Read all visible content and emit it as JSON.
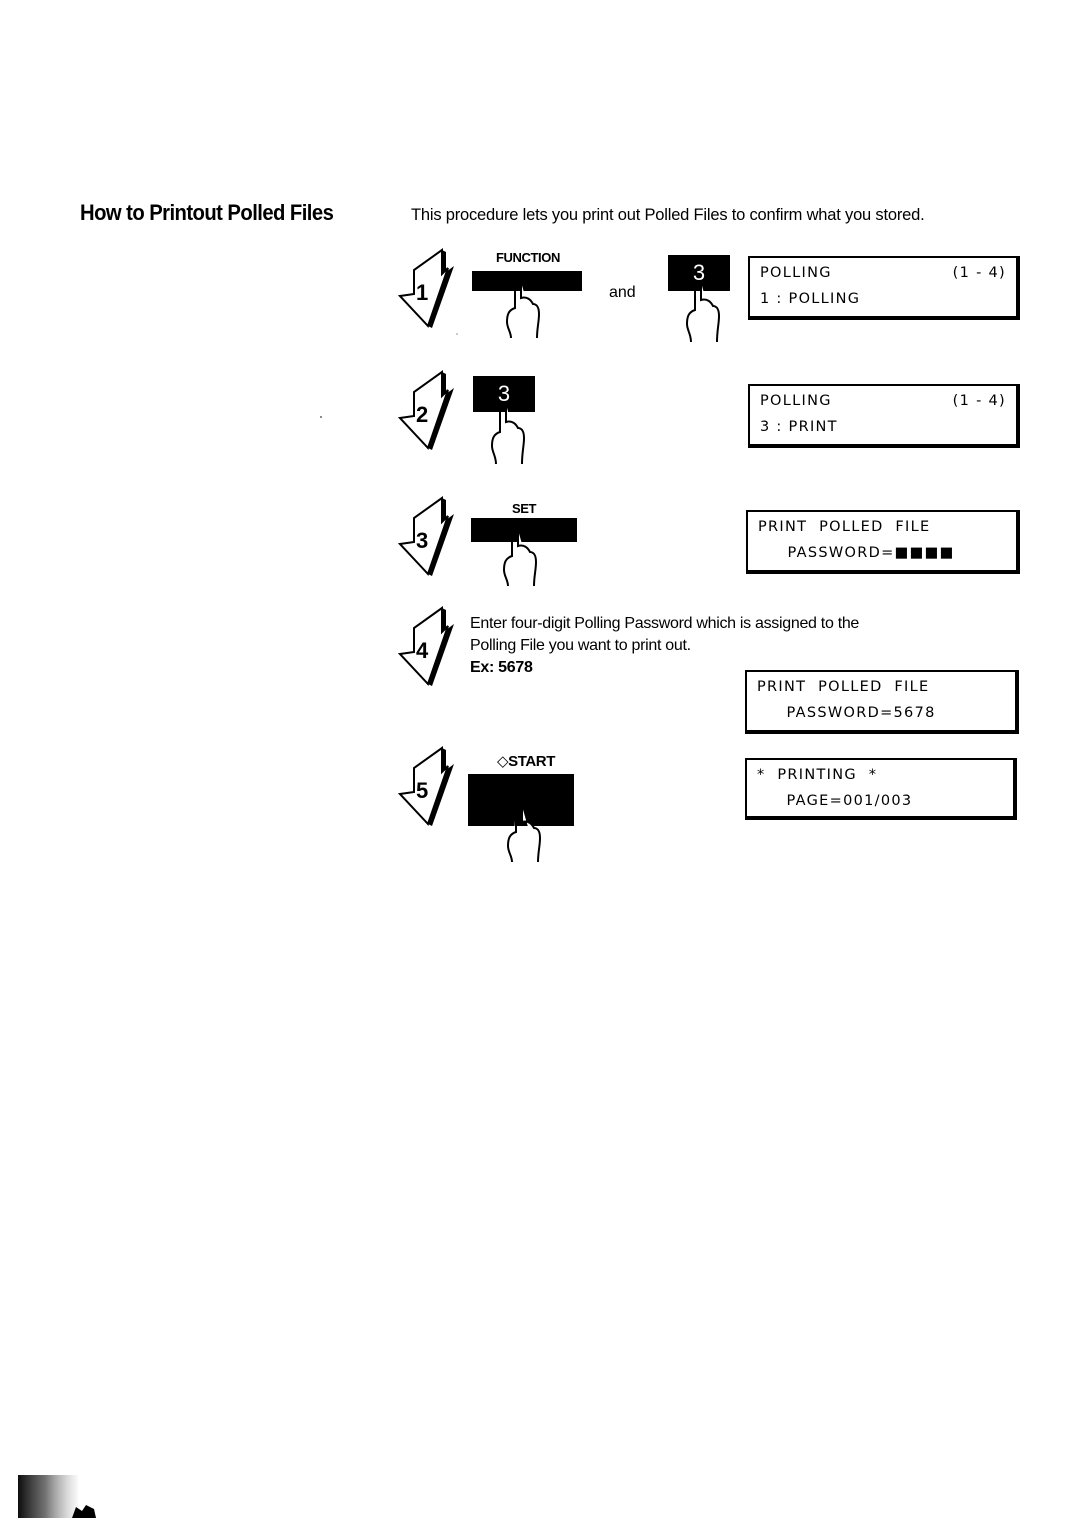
{
  "section": {
    "title": "How to Printout Polled Files",
    "intro": "This procedure lets you print out Polled Files to confirm what you stored."
  },
  "steps": [
    {
      "number": "1",
      "keys": [
        {
          "label": "FUNCTION",
          "type": "bar"
        },
        {
          "label": "3",
          "type": "number"
        }
      ],
      "connector": "and",
      "display": {
        "line1_left": "POLLING",
        "line1_right": "(1 - 4)",
        "line2": "1 : POLLING"
      }
    },
    {
      "number": "2",
      "keys": [
        {
          "label": "3",
          "type": "number"
        }
      ],
      "display": {
        "line1_left": "POLLING",
        "line1_right": "(1 - 4)",
        "line2": "3 : PRINT"
      }
    },
    {
      "number": "3",
      "keys": [
        {
          "label": "SET",
          "type": "bar"
        }
      ],
      "display": {
        "line1_left": "PRINT  POLLED  FILE",
        "line1_right": "",
        "line2": "     PASSWORD=■■■■"
      }
    },
    {
      "number": "4",
      "instruction_line1": "Enter four-digit Polling Password which is assigned to the",
      "instruction_line2": "Polling File you want to print out.",
      "example": "Ex:  5678",
      "display": {
        "line1_left": "PRINT  POLLED  FILE",
        "line1_right": "",
        "line2": "     PASSWORD=5678"
      }
    },
    {
      "number": "5",
      "keys": [
        {
          "label": "START",
          "icon": "start-diamond-icon",
          "type": "large"
        }
      ],
      "display": {
        "line1_left": "*  PRINTING  *",
        "line1_right": "",
        "line2": "     PAGE=001/003"
      }
    }
  ]
}
